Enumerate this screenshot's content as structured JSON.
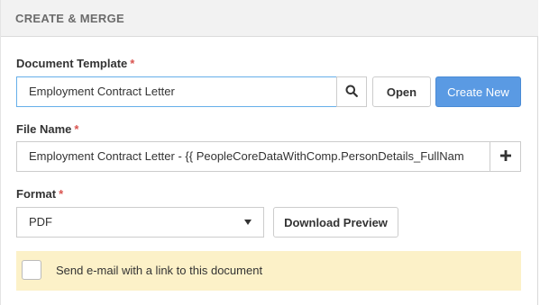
{
  "panel": {
    "title": "CREATE & MERGE"
  },
  "document_template": {
    "label": "Document Template",
    "required_mark": "*",
    "value": "Employment Contract Letter",
    "search_icon": "search-icon",
    "open_label": "Open",
    "create_new_label": "Create New"
  },
  "file_name": {
    "label": "File Name",
    "required_mark": "*",
    "value": "Employment Contract Letter - {{ PeopleCoreDataWithComp.PersonDetails_FullNam",
    "add_icon": "plus-icon"
  },
  "format": {
    "label": "Format",
    "required_mark": "*",
    "selected": "PDF",
    "download_preview_label": "Download Preview"
  },
  "email_option": {
    "checked": false,
    "label": "Send e-mail with a link to this document"
  },
  "colors": {
    "primary": "#5a9ae3",
    "required": "#d9534f",
    "notice_bg": "#fcf1c8"
  }
}
